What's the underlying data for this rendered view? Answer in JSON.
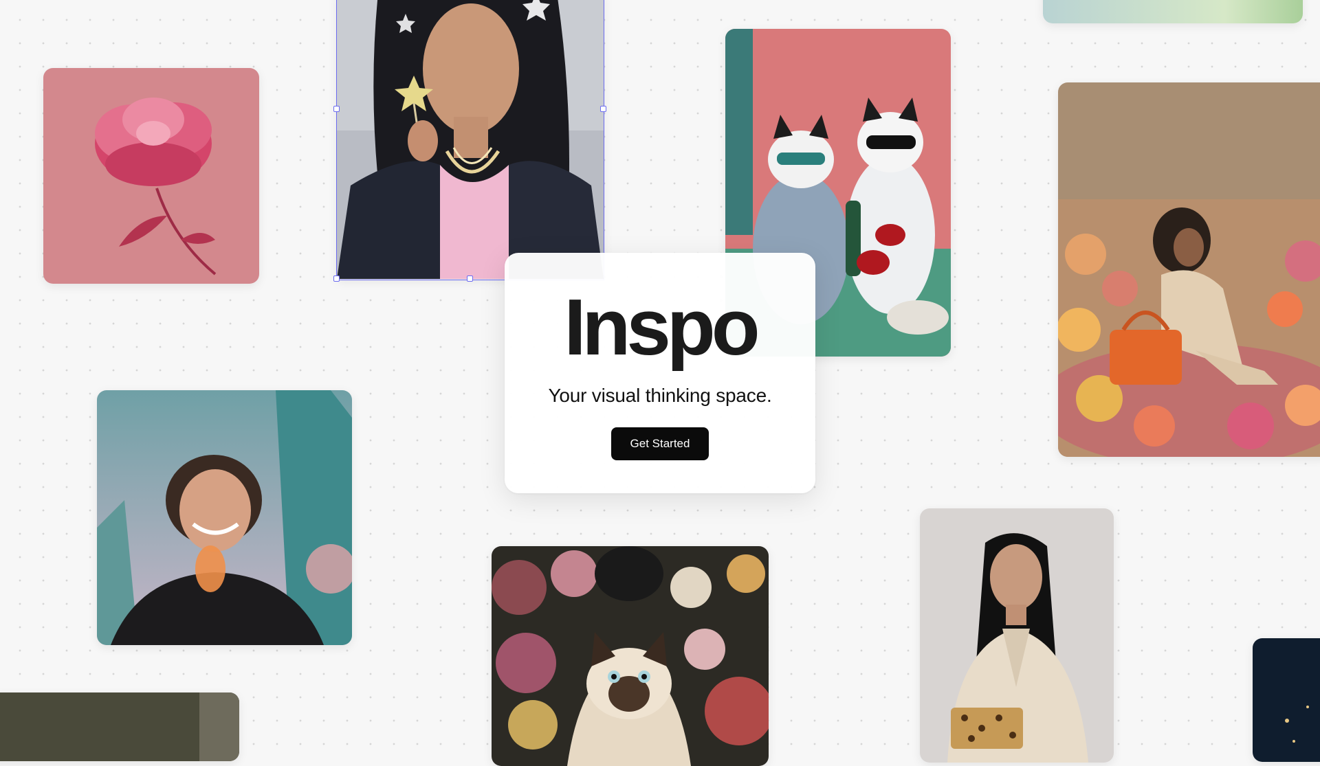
{
  "hero": {
    "title": "Inspo",
    "tagline": "Your visual thinking space.",
    "cta_label": "Get Started"
  },
  "cards": [
    {
      "name": "peony-flower-image",
      "depicts": "pink peony flower on pink background"
    },
    {
      "name": "girl-star-wand-image",
      "depicts": "woman in black puffer jacket holding star wand"
    },
    {
      "name": "cats-sunglasses-painting",
      "depicts": "painting of two cats in sunglasses with wine"
    },
    {
      "name": "woman-flower-field-image",
      "depicts": "woman sitting in flower field with orange bag"
    },
    {
      "name": "smiling-person-image",
      "depicts": "smiling curly-haired person against city sky"
    },
    {
      "name": "siamese-cat-flowers-image",
      "depicts": "siamese cat among painted flowers"
    },
    {
      "name": "woman-beige-coat-image",
      "depicts": "woman in beige coat with leopard clutch"
    }
  ],
  "colors": {
    "background": "#f7f7f7",
    "selection": "#6b6bf0",
    "cta_background": "#0b0b0b"
  }
}
